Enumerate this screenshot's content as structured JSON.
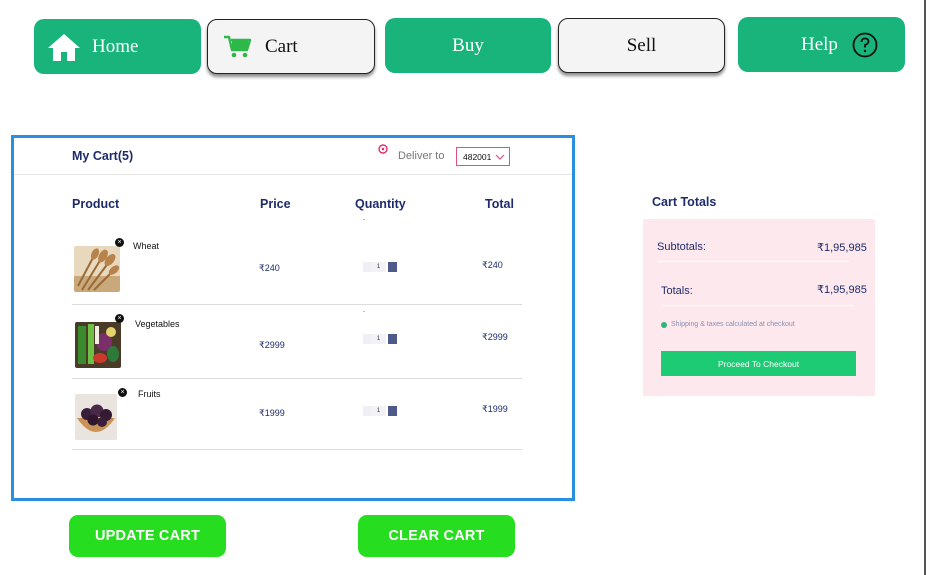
{
  "nav": {
    "home": "Home",
    "cart": "Cart",
    "buy": "Buy",
    "sell": "Sell",
    "help": "Help"
  },
  "cart": {
    "title": "My Cart(5)",
    "deliver_label": "Deliver to",
    "pincode": "482001",
    "columns": {
      "product": "Product",
      "price": "Price",
      "quantity": "Quantity",
      "total": "Total"
    },
    "items": [
      {
        "name": "Wheat",
        "price": "₹240",
        "qty": "1",
        "total": "₹240",
        "image": "wheat-photo"
      },
      {
        "name": "Vegetables",
        "price": "₹2999",
        "qty": "1",
        "total": "₹2999",
        "image": "vegetables-photo"
      },
      {
        "name": "Fruits",
        "price": "₹1999",
        "qty": "1",
        "total": "₹1999",
        "image": "fruits-photo"
      }
    ]
  },
  "totals": {
    "title": "Cart Totals",
    "subtotal_label": "Subtotals:",
    "subtotal_value": "₹1,95,985",
    "total_label": "Totals:",
    "total_value": "₹1,95,985",
    "shipping_note": "Shipping & taxes calculated at checkout",
    "checkout": "Proceed To Checkout"
  },
  "actions": {
    "update": "UPDATE CART",
    "clear": "CLEAR CART"
  },
  "icons": {
    "home": "home-icon",
    "cart": "shopping-cart-icon",
    "help": "question-circle-icon",
    "location": "location-pin-icon",
    "dropdown": "chevron-down-icon",
    "remove": "remove-x-icon"
  },
  "colors": {
    "nav_green": "#19b47c",
    "panel_border": "#2a8fe0",
    "action_green": "#27dd20",
    "checkout_green": "#1ecb75",
    "totals_bg": "#fde8ee",
    "text_navy": "#1d2b6b"
  }
}
